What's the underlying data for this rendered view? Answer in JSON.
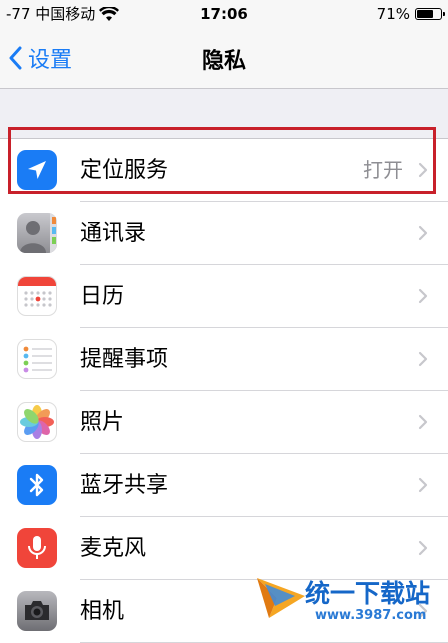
{
  "status_bar": {
    "carrier": "-77 中国移动",
    "time": "17:06",
    "battery_percent": "71%",
    "battery_level": 0.71
  },
  "nav": {
    "back_label": "设置",
    "title": "隐私"
  },
  "rows": [
    {
      "label": "定位服务",
      "value": "打开",
      "icon": "location-arrow-icon",
      "color": "#1a7cf5"
    },
    {
      "label": "通讯录",
      "icon": "contacts-icon",
      "color": "#9a9a9f"
    },
    {
      "label": "日历",
      "icon": "calendar-icon",
      "color": "#ffffff"
    },
    {
      "label": "提醒事项",
      "icon": "reminders-icon",
      "color": "#ffffff"
    },
    {
      "label": "照片",
      "icon": "photos-icon",
      "color": "#ffffff"
    },
    {
      "label": "蓝牙共享",
      "icon": "bluetooth-icon",
      "color": "#1a7cf5"
    },
    {
      "label": "麦克风",
      "icon": "microphone-icon",
      "color": "#f0453a"
    },
    {
      "label": "相机",
      "icon": "camera-icon",
      "color": "#8e8e93"
    }
  ],
  "highlight_color": "#c8202a",
  "watermark": {
    "text": "统一下载站",
    "url": "www.3987.com"
  }
}
